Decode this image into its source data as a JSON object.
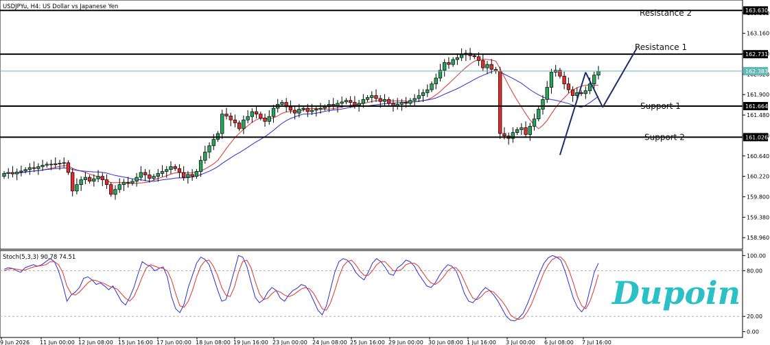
{
  "chart_data": [
    {
      "type": "candlestick",
      "title": "USDJPYu, H4:  US Dollar vs Japanese Yen",
      "ylim": [
        158.78,
        163.76
      ],
      "y_ticks": [
        158.96,
        159.38,
        159.8,
        160.22,
        160.64,
        161.06,
        161.48,
        161.9,
        162.32,
        162.74,
        163.16,
        163.58
      ],
      "x_ticks": [
        "9 Jun 2026",
        "11 Jun 00:00",
        "12 Jun 08:00",
        "15 Jun 16:00",
        "17 Jun 00:00",
        "18 Jun 08:00",
        "19 Jun 16:00",
        "23 Jun 00:00",
        "24 Jun 08:00",
        "25 Jun 16:00",
        "29 Jun 00:00",
        "30 Jun 08:00",
        "1 Jul 16:00",
        "3 Jul 00:00",
        "6 Jul 08:00",
        "7 Jul 16:00"
      ],
      "price_labels": {
        "resistance2": "163.630",
        "resistance1": "162.731",
        "current": "162.383",
        "support1": "161.664",
        "support2": "161.026"
      },
      "levels": [
        {
          "name": "Resistance 2",
          "value": 163.63
        },
        {
          "name": "Resistance 1",
          "value": 162.731
        },
        {
          "name": "Support 1",
          "value": 161.664
        },
        {
          "name": "Support 2",
          "value": 161.026
        }
      ],
      "current_price": 162.383,
      "candles_close": [
        160.28,
        160.3,
        160.27,
        160.31,
        160.33,
        160.36,
        160.4,
        160.38,
        160.42,
        160.45,
        160.47,
        160.46,
        160.48,
        160.49,
        160.5,
        160.3,
        159.92,
        160.05,
        160.15,
        160.2,
        160.12,
        160.17,
        160.22,
        160.15,
        160.05,
        159.85,
        159.95,
        160.05,
        160.1,
        160.08,
        160.12,
        160.2,
        160.3,
        160.25,
        160.18,
        160.22,
        160.28,
        160.32,
        160.36,
        160.42,
        160.38,
        160.3,
        160.2,
        160.26,
        160.22,
        160.32,
        160.55,
        160.72,
        160.85,
        160.98,
        161.1,
        161.5,
        161.46,
        161.38,
        161.32,
        161.2,
        161.38,
        161.45,
        161.55,
        161.5,
        161.42,
        161.35,
        161.45,
        161.62,
        161.7,
        161.74,
        161.65,
        161.58,
        161.52,
        161.6,
        161.62,
        161.55,
        161.58,
        161.6,
        161.62,
        161.65,
        161.7,
        161.66,
        161.72,
        161.75,
        161.78,
        161.74,
        161.68,
        161.72,
        161.8,
        161.84,
        161.88,
        161.82,
        161.76,
        161.8,
        161.72,
        161.66,
        161.7,
        161.74,
        161.72,
        161.78,
        161.82,
        161.88,
        161.94,
        162.0,
        162.12,
        162.24,
        162.4,
        162.56,
        162.52,
        162.62,
        162.66,
        162.72,
        162.75,
        162.7,
        162.68,
        162.6,
        162.45,
        162.52,
        162.42,
        162.38,
        161.1,
        161.05,
        161.0,
        161.12,
        161.18,
        161.22,
        161.08,
        161.25,
        161.4,
        161.6,
        161.8,
        162.05,
        162.36,
        162.4,
        162.28,
        162.12,
        162.0,
        161.88,
        161.94,
        161.92,
        161.98,
        162.12,
        162.3,
        162.38
      ],
      "candles_open": [
        160.22,
        160.28,
        160.3,
        160.27,
        160.31,
        160.33,
        160.36,
        160.4,
        160.38,
        160.42,
        160.45,
        160.47,
        160.46,
        160.48,
        160.49,
        160.5,
        160.3,
        159.92,
        160.05,
        160.15,
        160.2,
        160.12,
        160.17,
        160.22,
        160.15,
        160.05,
        159.85,
        159.95,
        160.05,
        160.1,
        160.08,
        160.12,
        160.2,
        160.3,
        160.25,
        160.18,
        160.22,
        160.28,
        160.32,
        160.36,
        160.42,
        160.38,
        160.3,
        160.2,
        160.26,
        160.22,
        160.32,
        160.55,
        160.72,
        160.85,
        160.98,
        161.1,
        161.5,
        161.46,
        161.38,
        161.32,
        161.2,
        161.38,
        161.45,
        161.55,
        161.5,
        161.42,
        161.35,
        161.45,
        161.62,
        161.7,
        161.74,
        161.65,
        161.58,
        161.52,
        161.6,
        161.62,
        161.55,
        161.58,
        161.6,
        161.62,
        161.65,
        161.7,
        161.66,
        161.72,
        161.75,
        161.78,
        161.74,
        161.68,
        161.72,
        161.8,
        161.84,
        161.88,
        161.82,
        161.76,
        161.8,
        161.72,
        161.66,
        161.7,
        161.74,
        161.72,
        161.78,
        161.82,
        161.88,
        161.94,
        162.0,
        162.12,
        162.24,
        162.4,
        162.56,
        162.52,
        162.62,
        162.66,
        162.72,
        162.75,
        162.7,
        162.68,
        162.6,
        162.45,
        162.52,
        162.42,
        162.38,
        161.1,
        161.05,
        161.0,
        161.12,
        161.18,
        161.22,
        161.08,
        161.25,
        161.4,
        161.6,
        161.8,
        162.05,
        162.36,
        162.4,
        162.28,
        162.12,
        162.0,
        161.88,
        161.94,
        161.92,
        161.98,
        162.12,
        162.3
      ],
      "drawn_lines": [
        {
          "name": "trend-up",
          "points": [
            [
              130,
              160.66
            ],
            [
              136,
              162.36
            ]
          ]
        },
        {
          "name": "trend-pullback",
          "points": [
            [
              136,
              162.36
            ],
            [
              140,
              161.64
            ]
          ]
        },
        {
          "name": "trend-projection",
          "points": [
            [
              140,
              161.64
            ],
            [
              148,
              162.86
            ]
          ]
        }
      ]
    },
    {
      "type": "line",
      "title": "Stoch(5,3,3) 90.78 74.51",
      "ylim": [
        -5,
        103
      ],
      "y_ticks": [
        "100.00",
        "80.00",
        "20.00",
        "0.00"
      ],
      "levels": [
        80,
        20
      ],
      "series": [
        {
          "name": "Stoch main",
          "color": "#2b2bd6",
          "values": [
            82,
            84,
            83,
            80,
            78,
            84,
            86,
            88,
            86,
            88,
            92,
            96,
            92,
            80,
            62,
            40,
            48,
            52,
            58,
            70,
            72,
            68,
            62,
            64,
            60,
            55,
            60,
            50,
            40,
            35,
            45,
            58,
            76,
            92,
            88,
            86,
            80,
            83,
            85,
            72,
            46,
            30,
            25,
            36,
            58,
            74,
            90,
            98,
            95,
            88,
            72,
            55,
            40,
            42,
            60,
            80,
            100,
            98,
            86,
            65,
            45,
            38,
            42,
            52,
            58,
            54,
            44,
            40,
            48,
            54,
            57,
            62,
            60,
            52,
            40,
            28,
            22,
            34,
            56,
            78,
            92,
            96,
            94,
            88,
            78,
            72,
            68,
            78,
            90,
            96,
            92,
            85,
            76,
            74,
            84,
            88,
            94,
            92,
            86,
            76,
            68,
            60,
            58,
            64,
            74,
            82,
            88,
            86,
            80,
            66,
            50,
            40,
            38,
            44,
            52,
            58,
            54,
            48,
            40,
            30,
            20,
            15,
            14,
            18,
            24,
            36,
            50,
            64,
            78,
            90,
            97,
            100,
            98,
            94,
            80,
            62,
            44,
            32,
            26,
            34,
            56,
            78,
            90
          ]
        },
        {
          "name": "Stoch signal",
          "color": "#e03030",
          "values": [
            80,
            82,
            83,
            82,
            81,
            81,
            83,
            85,
            86,
            87,
            88,
            92,
            92,
            88,
            78,
            60,
            50,
            48,
            52,
            58,
            64,
            68,
            67,
            65,
            63,
            60,
            58,
            56,
            50,
            44,
            40,
            46,
            58,
            72,
            84,
            88,
            86,
            84,
            83,
            80,
            68,
            50,
            34,
            32,
            40,
            54,
            72,
            86,
            93,
            94,
            86,
            74,
            58,
            48,
            46,
            58,
            78,
            92,
            94,
            84,
            66,
            50,
            42,
            44,
            50,
            54,
            52,
            48,
            46,
            48,
            52,
            56,
            58,
            56,
            50,
            40,
            30,
            28,
            38,
            54,
            72,
            86,
            92,
            94,
            88,
            80,
            74,
            74,
            80,
            88,
            92,
            92,
            86,
            80,
            80,
            82,
            88,
            90,
            90,
            86,
            78,
            70,
            64,
            62,
            66,
            72,
            80,
            84,
            84,
            78,
            66,
            54,
            44,
            42,
            46,
            52,
            54,
            52,
            46,
            40,
            32,
            22,
            18,
            16,
            18,
            26,
            36,
            50,
            64,
            78,
            88,
            95,
            98,
            98,
            92,
            80,
            64,
            46,
            34,
            30,
            40,
            56,
            75
          ]
        }
      ]
    }
  ],
  "watermark": {
    "brand": "Dupoin",
    "color": "#2bbfc6"
  }
}
